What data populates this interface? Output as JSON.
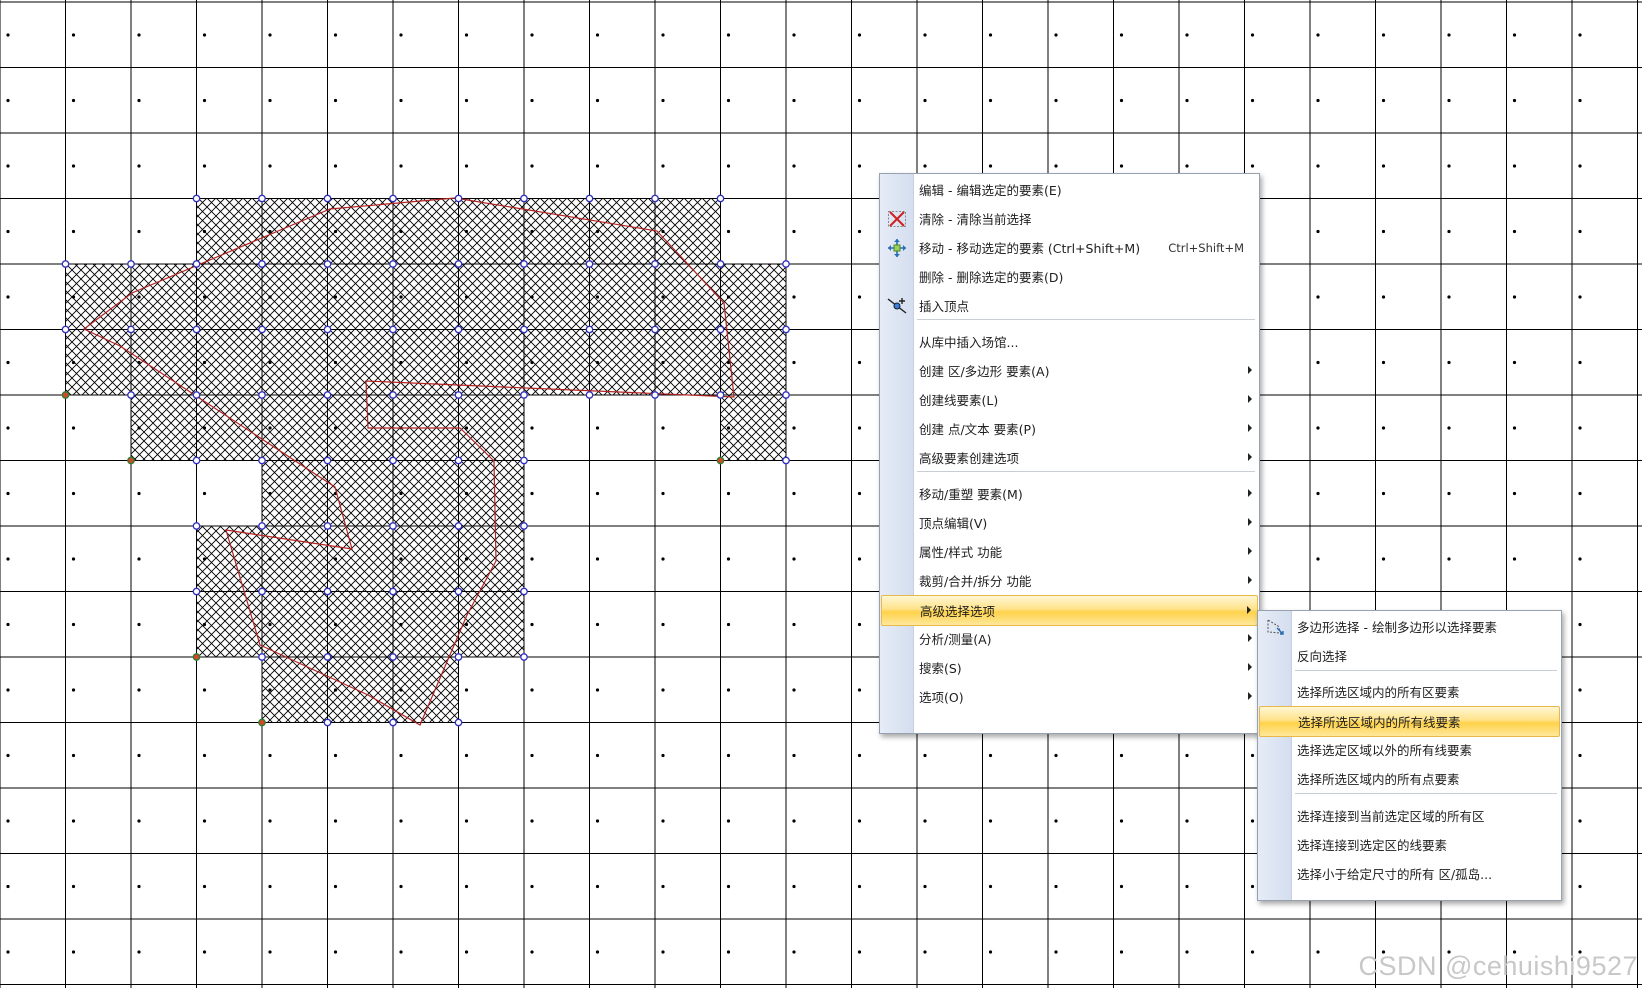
{
  "context_menu": {
    "items": [
      {
        "label": "编辑 - 编辑选定的要素(E)",
        "icon": null,
        "submenu": false
      },
      {
        "label": "清除 - 清除当前选择",
        "icon": "clear-selection-icon",
        "submenu": false
      },
      {
        "label": "移动 - 移动选定的要素 (Ctrl+Shift+M)",
        "shortcut": "Ctrl+Shift+M",
        "icon": "move-arrows-icon",
        "submenu": false
      },
      {
        "label": "删除 - 删除选定的要素(D)",
        "icon": null,
        "submenu": false
      },
      {
        "label": "插入顶点",
        "icon": "insert-vertex-icon",
        "submenu": false
      },
      {
        "label": "从库中插入场馆...",
        "icon": null,
        "submenu": false
      },
      {
        "label": "创建 区/多边形 要素(A)",
        "icon": null,
        "submenu": true
      },
      {
        "label": "创建线要素(L)",
        "icon": null,
        "submenu": true
      },
      {
        "label": "创建 点/文本 要素(P)",
        "icon": null,
        "submenu": true
      },
      {
        "label": "高级要素创建选项",
        "icon": null,
        "submenu": true
      },
      {
        "label": "移动/重塑 要素(M)",
        "icon": null,
        "submenu": true
      },
      {
        "label": "顶点编辑(V)",
        "icon": null,
        "submenu": true
      },
      {
        "label": "属性/样式 功能",
        "icon": null,
        "submenu": true
      },
      {
        "label": "裁剪/合并/拆分 功能",
        "icon": null,
        "submenu": true
      },
      {
        "label": "高级选择选项",
        "icon": null,
        "submenu": true,
        "highlighted": true
      },
      {
        "label": "分析/测量(A)",
        "icon": null,
        "submenu": true
      },
      {
        "label": "搜索(S)",
        "icon": null,
        "submenu": true
      },
      {
        "label": "选项(O)",
        "icon": null,
        "submenu": true
      }
    ]
  },
  "submenu": {
    "items": [
      {
        "label": "多边形选择 - 绘制多边形以选择要素",
        "icon": "polygon-select-icon"
      },
      {
        "label": "反向选择",
        "icon": null
      },
      {
        "label": "选择所选区域内的所有区要素",
        "icon": null
      },
      {
        "label": "选择所选区域内的所有线要素",
        "icon": null,
        "highlighted": true
      },
      {
        "label": "选择选定区域以外的所有线要素",
        "icon": null
      },
      {
        "label": "选择所选区域内的所有点要素",
        "icon": null
      },
      {
        "label": "选择连接到当前选定区域的所有区",
        "icon": null
      },
      {
        "label": "选择连接到选定区的线要素",
        "icon": null
      },
      {
        "label": "选择小于给定尺寸的所有 区/孤岛...",
        "icon": null
      }
    ]
  },
  "watermark": "CSDN @cehuishi9527",
  "colors": {
    "grid_line": "#000000",
    "selection_outline": "#b22222",
    "vertex_blue": "#3030c0",
    "vertex_green": "#2e7d32",
    "menu_highlight": "#ffd24a"
  }
}
